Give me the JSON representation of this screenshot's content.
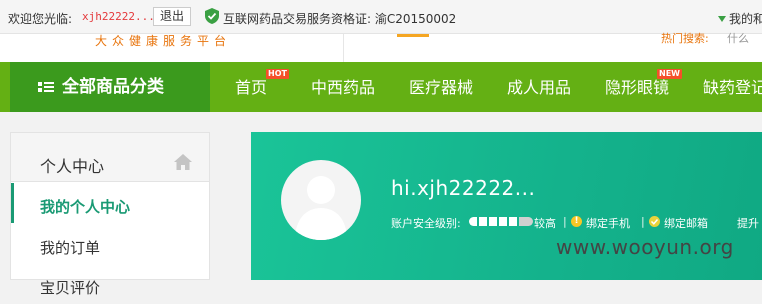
{
  "topbar": {
    "welcome": "欢迎您光临:",
    "username": "xjh22222...",
    "logout": "退出",
    "license": "互联网药品交易服务资格证: 渝C20150002",
    "my_corner": "我的和"
  },
  "header": {
    "slogan": "大众健康服务平台",
    "hot_search": "热门搜索:",
    "more": "什么"
  },
  "nav": {
    "all_categories": "全部商品分类",
    "items": [
      {
        "label": "首页",
        "badge": "HOT"
      },
      {
        "label": "中西药品",
        "badge": ""
      },
      {
        "label": "医疗器械",
        "badge": ""
      },
      {
        "label": "成人用品",
        "badge": ""
      },
      {
        "label": "隐形眼镜",
        "badge": "NEW"
      },
      {
        "label": "缺药登记",
        "badge": ""
      }
    ],
    "colors": {
      "bar": "#64b014",
      "category": "#3b9a1d",
      "badge": "#f5502a"
    }
  },
  "sidebar": {
    "title": "个人中心",
    "items": [
      {
        "label": "我的个人中心",
        "active": true
      },
      {
        "label": "我的订单",
        "active": false
      },
      {
        "label": "宝贝评价",
        "active": false
      }
    ],
    "accent": "#1a9a74"
  },
  "profile": {
    "greeting": "hi.xjh22222...",
    "security_label": "账户安全级别:",
    "security_level_text": "较高",
    "security_level": 0.8,
    "separator": "|",
    "bind_phone": "绑定手机",
    "bind_email": "绑定邮箱",
    "extra": "提升",
    "banner_color": "#14b28c"
  },
  "watermark": "www.wooyun.org"
}
